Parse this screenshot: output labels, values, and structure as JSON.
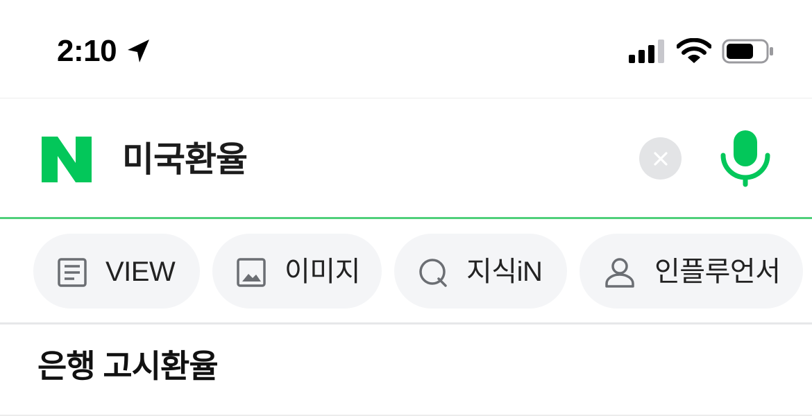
{
  "status_bar": {
    "time": "2:10",
    "icons": [
      "location-arrow-icon",
      "cellular-signal-icon",
      "wifi-icon",
      "battery-icon"
    ]
  },
  "search": {
    "logo": "N",
    "query": "미국환율",
    "clear_icon": "close-icon",
    "voice_icon": "microphone-icon"
  },
  "tabs": [
    {
      "label": "VIEW",
      "icon": "document-icon"
    },
    {
      "label": "이미지",
      "icon": "image-icon"
    },
    {
      "label": "지식iN",
      "icon": "q-search-icon"
    },
    {
      "label": "인플루언서",
      "icon": "person-icon"
    }
  ],
  "section": {
    "title": "은행 고시환율"
  },
  "colors": {
    "brand_green": "#03c75a",
    "underline_green": "#4fd07a",
    "chip_bg": "#f4f5f7",
    "clear_bg": "#e3e4e6",
    "icon_gray": "#6b6e73"
  }
}
